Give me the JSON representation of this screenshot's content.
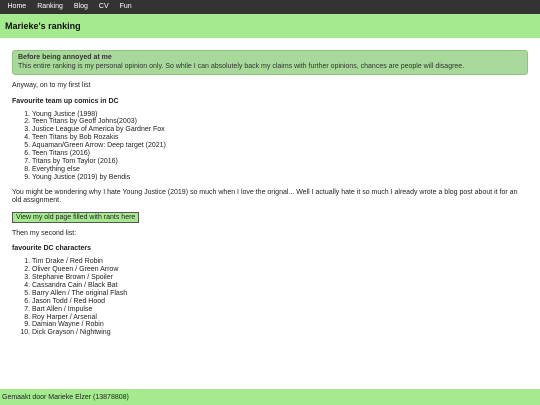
{
  "nav": {
    "items": [
      "Home",
      "Ranking",
      "Blog",
      "CV",
      "Fun"
    ]
  },
  "header": {
    "title": "Marieke's ranking"
  },
  "alert": {
    "title": "Before being annoyed at me",
    "text": "This entire ranking is my personal opinion only. So while I can absolutely back my claims with further opinions, chances are people will disagree."
  },
  "intro": "Anyway, on to my first list",
  "list1": {
    "heading": "Favourite team up comics in DC",
    "items": [
      "Young Justice (1998)",
      "Teen Titans by Geoff Johns(2003)",
      "Justice League of America by Gardner Fox",
      "Teen Titans by Bob Rozakis",
      "Aquaman/Green Arrow: Deep target (2021)",
      "Teen Titans (2016)",
      "Titans by Tom Taylor (2016)",
      "Everything else",
      "Young Justice (2019) by Bendis"
    ]
  },
  "rant": "You might be wondering why I hate Young Justice (2019) so much when I love the orignal... Well I actually hate it so much I already wrote a blog post about it for an old assignment.",
  "rant_button": "View my old page filled with rants here",
  "then": "Then my second list:",
  "list2": {
    "heading": "favourite DC characters",
    "items": [
      "Tim Drake / Red Robin",
      "Oliver Queen / Green Arrow",
      "Stephanie Brown / Spoiler",
      "Cassandra Cain / Black Bat",
      "Barry Allen / The original Flash",
      "Jason Todd / Red Hood",
      "Bart Allen / Impulse",
      "Roy Harper / Arsenal",
      "Damian Wayne / Robin",
      "Dick Grayson / Nightwing"
    ]
  },
  "footer": {
    "text": "Gemaakt door Marieke Elzer (13878808)"
  },
  "colors": {
    "nav_bg": "#333333",
    "accent_green": "#a6ea8f",
    "alert_bg": "#a9d99a"
  }
}
